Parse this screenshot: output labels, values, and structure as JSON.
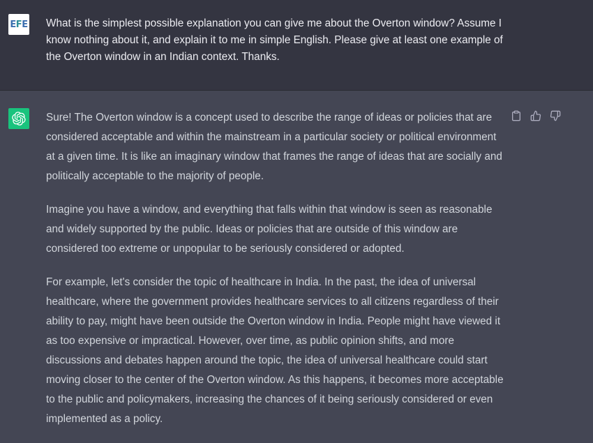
{
  "user_message": {
    "avatar": {
      "letters": [
        "E",
        "F",
        "E"
      ]
    },
    "text": "What is the simplest possible explanation you can give me about the Overton window? Assume I know nothing about it, and explain it to me in simple English. Please give at least one example of the Overton window in an Indian context. Thanks."
  },
  "assistant_message": {
    "avatar_icon": "openai-logo-icon",
    "paragraphs": [
      "Sure! The Overton window is a concept used to describe the range of ideas or policies that are considered acceptable and within the mainstream in a particular society or political environment at a given time. It is like an imaginary window that frames the range of ideas that are socially and politically acceptable to the majority of people.",
      "Imagine you have a window, and everything that falls within that window is seen as reasonable and widely supported by the public. Ideas or policies that are outside of this window are considered too extreme or unpopular to be seriously considered or adopted.",
      "For example, let's consider the topic of healthcare in India. In the past, the idea of universal healthcare, where the government provides healthcare services to all citizens regardless of their ability to pay, might have been outside the Overton window in India. People might have viewed it as too expensive or impractical. However, over time, as public opinion shifts, and more discussions and debates happen around the topic, the idea of universal healthcare could start moving closer to the center of the Overton window. As this happens, it becomes more acceptable to the public and policymakers, increasing the chances of it being seriously considered or even implemented as a policy."
    ],
    "actions": [
      "copy-icon",
      "thumbs-up-icon",
      "thumbs-down-icon"
    ]
  },
  "colors": {
    "user_bg": "#343541",
    "assistant_bg": "#444654",
    "gpt_avatar": "#19c37d",
    "text": "#d1d5db"
  }
}
